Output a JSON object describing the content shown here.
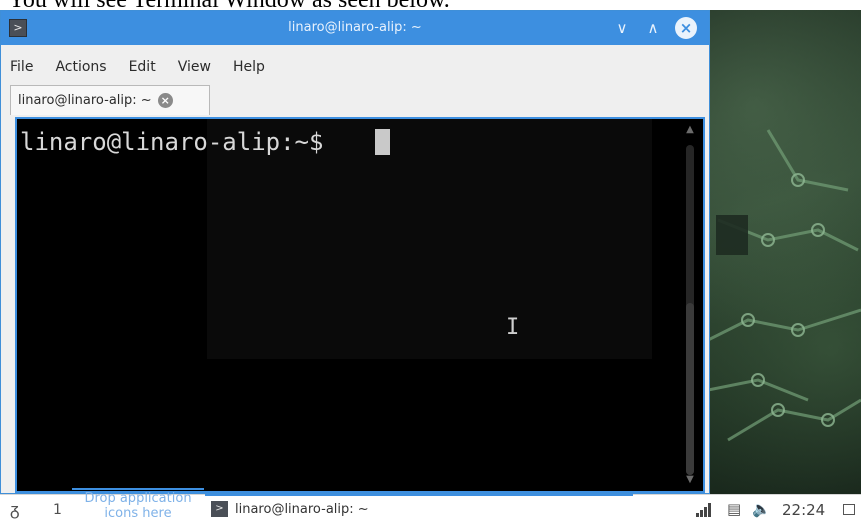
{
  "caption": {
    "text": "You will see Terminal Window as seen below."
  },
  "window": {
    "title": "linaro@linaro-alip: ~",
    "app_icon_glyph": ">",
    "buttons": {
      "minimize_glyph": "∨",
      "maximize_glyph": "∧",
      "close_glyph": "×"
    }
  },
  "menubar": {
    "items": [
      "File",
      "Actions",
      "Edit",
      "View",
      "Help"
    ]
  },
  "tab": {
    "label": "linaro@linaro-alip: ~",
    "close_glyph": "×"
  },
  "terminal": {
    "prompt": "linaro@linaro-alip:~$ ",
    "mouse_cursor_glyph": "I"
  },
  "taskbar": {
    "desktop_number": "1",
    "drop_text_line1": "Drop application",
    "drop_text_line2": "icons here",
    "task_icon_glyph": ">",
    "task_label": "linaro@linaro-alip: ~",
    "clock": "22:24"
  },
  "colors": {
    "accent": "#3d8fe0",
    "terminal_bg": "#000000",
    "text": "#d8d8d8"
  },
  "icons": [
    "terminal-app-icon",
    "minimize-icon",
    "maximize-icon",
    "close-icon",
    "tab-close-icon",
    "start-menu-icon",
    "network-signal-icon",
    "usb-icon",
    "volume-icon",
    "show-desktop-icon"
  ]
}
